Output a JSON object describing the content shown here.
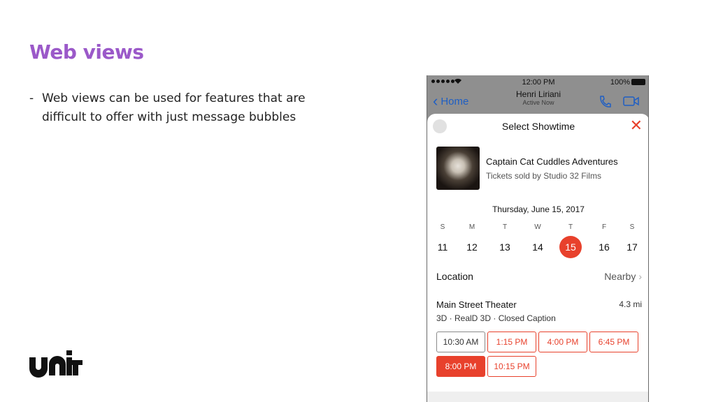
{
  "slide": {
    "title": "Web views",
    "bullets": [
      "Web views can be used for features that are difficult to offer with just message bubbles"
    ],
    "logo_text": "unit"
  },
  "phone": {
    "status_bar": {
      "time": "12:00 PM",
      "battery": "100%"
    },
    "nav": {
      "back_label": "Home",
      "contact_name": "Henri Liriani",
      "contact_status": "Active Now",
      "accent_color": "#1f5fc4"
    },
    "sheet": {
      "title": "Select Showtime",
      "close_icon": "close-icon",
      "movie": {
        "title": "Captain Cat Cuddles Adventures",
        "subtitle": "Tickets sold by Studio 32 Films"
      },
      "date_heading": "Thursday, June 15, 2017",
      "weekdays": [
        "S",
        "M",
        "T",
        "W",
        "T",
        "F",
        "S"
      ],
      "days": [
        "11",
        "12",
        "13",
        "14",
        "15",
        "16",
        "17"
      ],
      "selected_day": "15",
      "location_label": "Location",
      "location_value": "Nearby",
      "theater": {
        "name": "Main Street Theater",
        "distance": "4.3 mi",
        "features": "3D  ·  RealD 3D  ·  Closed Caption"
      },
      "showtimes": [
        {
          "time": "10:30 AM",
          "state": "disabled"
        },
        {
          "time": "1:15 PM",
          "state": "available"
        },
        {
          "time": "4:00 PM",
          "state": "available"
        },
        {
          "time": "6:45 PM",
          "state": "available"
        },
        {
          "time": "8:00 PM",
          "state": "selected"
        },
        {
          "time": "10:15 PM",
          "state": "available"
        }
      ],
      "accent_color": "#e8412c"
    }
  }
}
